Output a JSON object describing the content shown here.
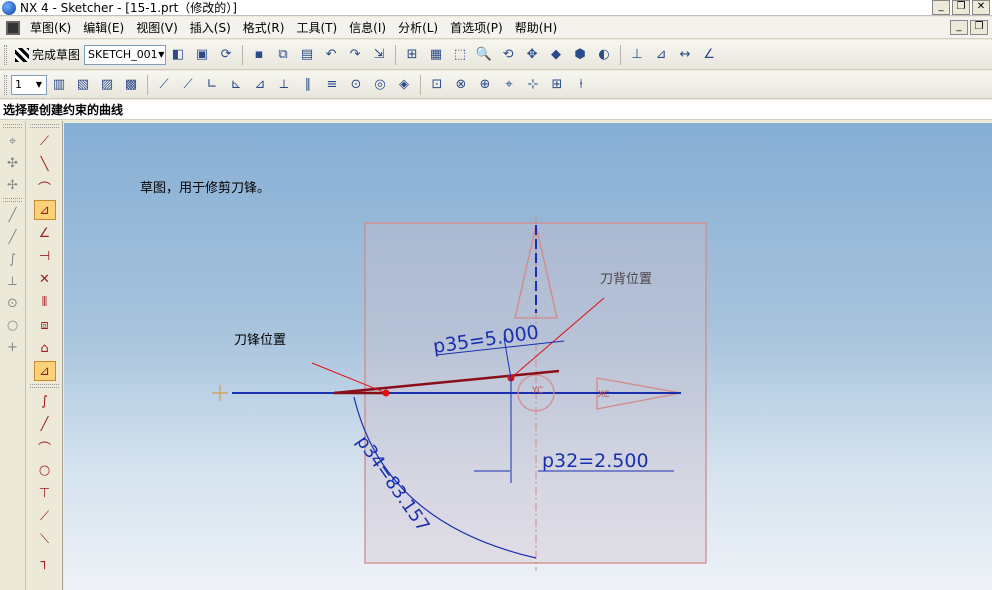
{
  "window": {
    "title": "NX 4 - Sketcher - [15-1.prt（修改的）]"
  },
  "window_buttons": [
    "_",
    "❐",
    "✕"
  ],
  "menu": [
    "草图(K)",
    "编辑(E)",
    "视图(V)",
    "插入(S)",
    "格式(R)",
    "工具(T)",
    "信息(I)",
    "分析(L)",
    "首选项(P)",
    "帮助(H)"
  ],
  "toolbar1": {
    "finish_label": "完成草图",
    "sketch_name": "SKETCH_001"
  },
  "toolbar2": {
    "layer_value": "1"
  },
  "status": {
    "prompt": "选择要创建约束的曲线"
  },
  "canvas": {
    "note": "草图，用于修剪刀锋。",
    "label_edge": "刀锋位置",
    "label_back": "刀背位置",
    "dim1": "p35=5.000",
    "dim2": "p32=2.500",
    "dim3": "p34=83.157",
    "axis_x": "XC",
    "axis_y": "YC"
  }
}
